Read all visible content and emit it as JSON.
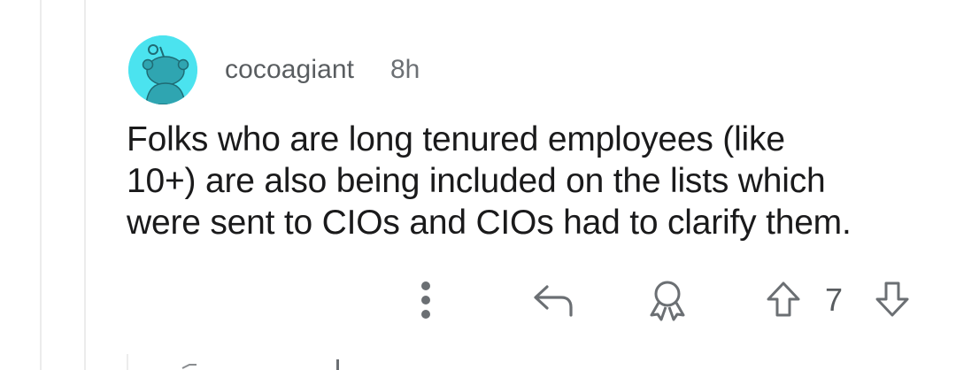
{
  "comment": {
    "author": "cocoagiant",
    "time": "8h",
    "body_lines": [
      "Folks who are long tenured employees (like",
      "10+) are also being included on the lists which",
      "were sent to CIOs and CIOs had to clarify them."
    ],
    "avatar_color": "#4be3ef",
    "avatar_icon": "snoo-avatar-icon"
  },
  "actions": {
    "more_icon": "vertical-ellipsis-icon",
    "reply_icon": "reply-arrow-icon",
    "award_icon": "award-icon",
    "upvote_icon": "upvote-arrow-icon",
    "vote_count": "7",
    "downvote_icon": "downvote-arrow-icon"
  }
}
